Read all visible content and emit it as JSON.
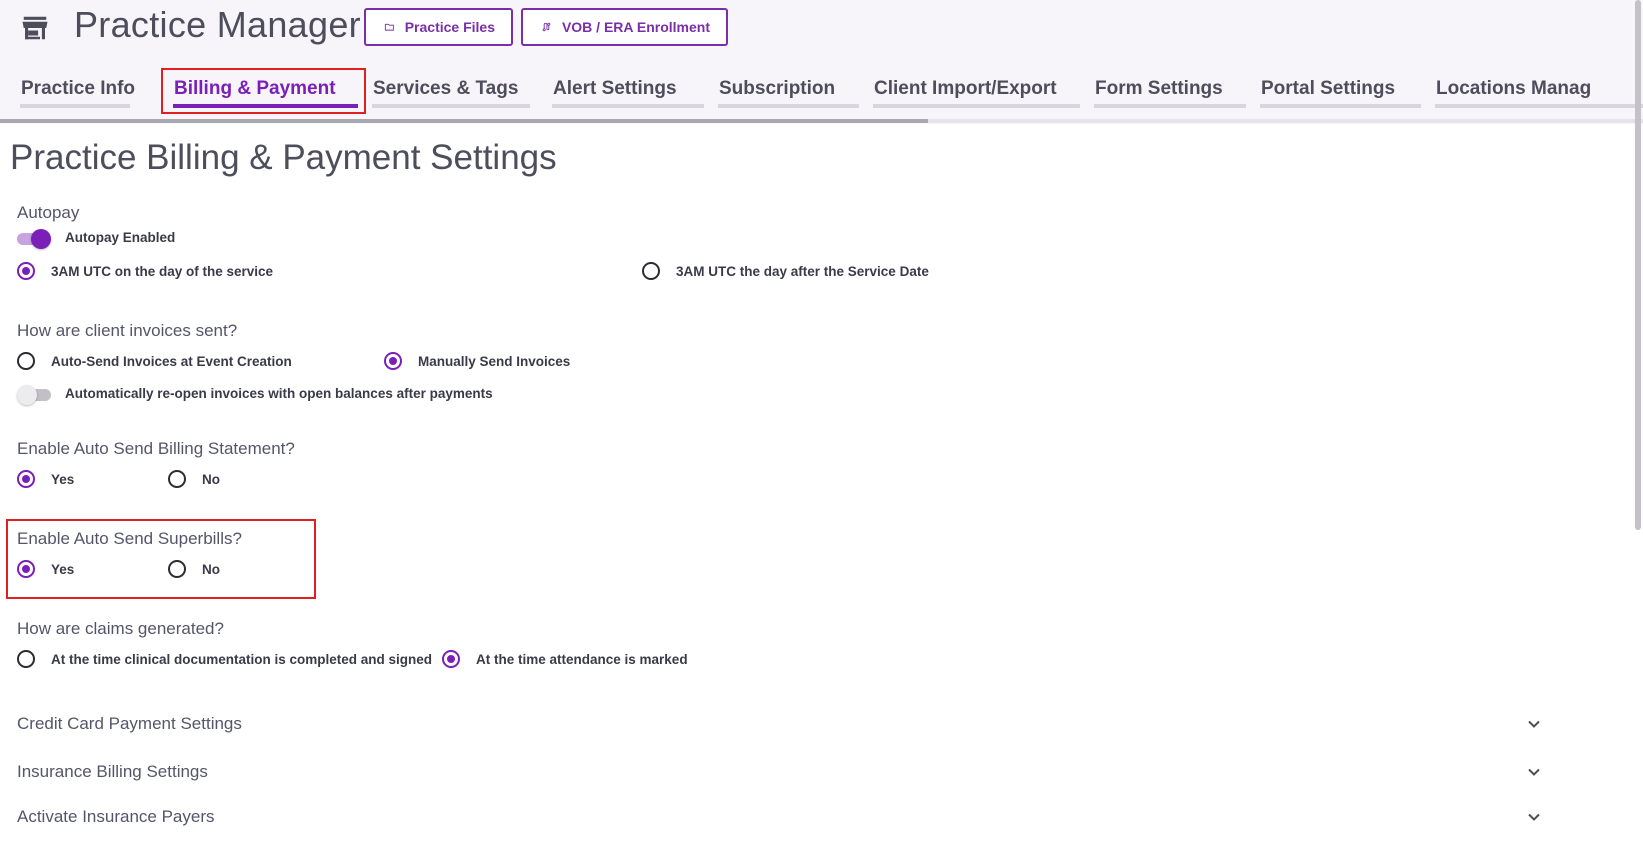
{
  "header": {
    "app_title": "Practice Manager",
    "store_icon": "store-icon",
    "buttons": [
      {
        "label": "Practice Files",
        "icon": "folder-icon"
      },
      {
        "label": "VOB / ERA Enrollment",
        "icon": "route-icon"
      }
    ]
  },
  "tabs": [
    {
      "label": "Practice Info",
      "active": false
    },
    {
      "label": "Billing & Payment",
      "active": true
    },
    {
      "label": "Services & Tags",
      "active": false
    },
    {
      "label": "Alert Settings",
      "active": false
    },
    {
      "label": "Subscription",
      "active": false
    },
    {
      "label": "Client Import/Export",
      "active": false
    },
    {
      "label": "Form Settings",
      "active": false
    },
    {
      "label": "Portal Settings",
      "active": false
    },
    {
      "label": "Locations Manag",
      "active": false
    }
  ],
  "page": {
    "title": "Practice Billing & Payment Settings",
    "autopay": {
      "label": "Autopay",
      "toggle_label": "Autopay Enabled",
      "toggle_on": true,
      "options": [
        {
          "label": "3AM UTC on the day of the service",
          "checked": true
        },
        {
          "label": "3AM UTC the day after the Service Date",
          "checked": false
        }
      ]
    },
    "invoices": {
      "label": "How are client invoices sent?",
      "options": [
        {
          "label": "Auto-Send Invoices at Event Creation",
          "checked": false
        },
        {
          "label": "Manually Send Invoices",
          "checked": true
        }
      ],
      "toggle_label": "Automatically re-open invoices with open balances after payments",
      "toggle_on": false
    },
    "billing_statement": {
      "label": "Enable Auto Send Billing Statement?",
      "options": [
        {
          "label": "Yes",
          "checked": true
        },
        {
          "label": "No",
          "checked": false
        }
      ]
    },
    "superbills": {
      "label": "Enable Auto Send Superbills?",
      "options": [
        {
          "label": "Yes",
          "checked": true
        },
        {
          "label": "No",
          "checked": false
        }
      ]
    },
    "claims": {
      "label": "How are claims generated?",
      "options": [
        {
          "label": "At the time clinical documentation is completed and signed",
          "checked": false
        },
        {
          "label": "At the time attendance is marked",
          "checked": true
        }
      ]
    },
    "accordions": [
      {
        "label": "Credit Card Payment Settings"
      },
      {
        "label": "Insurance Billing Settings"
      },
      {
        "label": "Activate Insurance Payers"
      }
    ]
  },
  "colors": {
    "accent": "#7a1fb8",
    "highlight": "#e02020"
  }
}
